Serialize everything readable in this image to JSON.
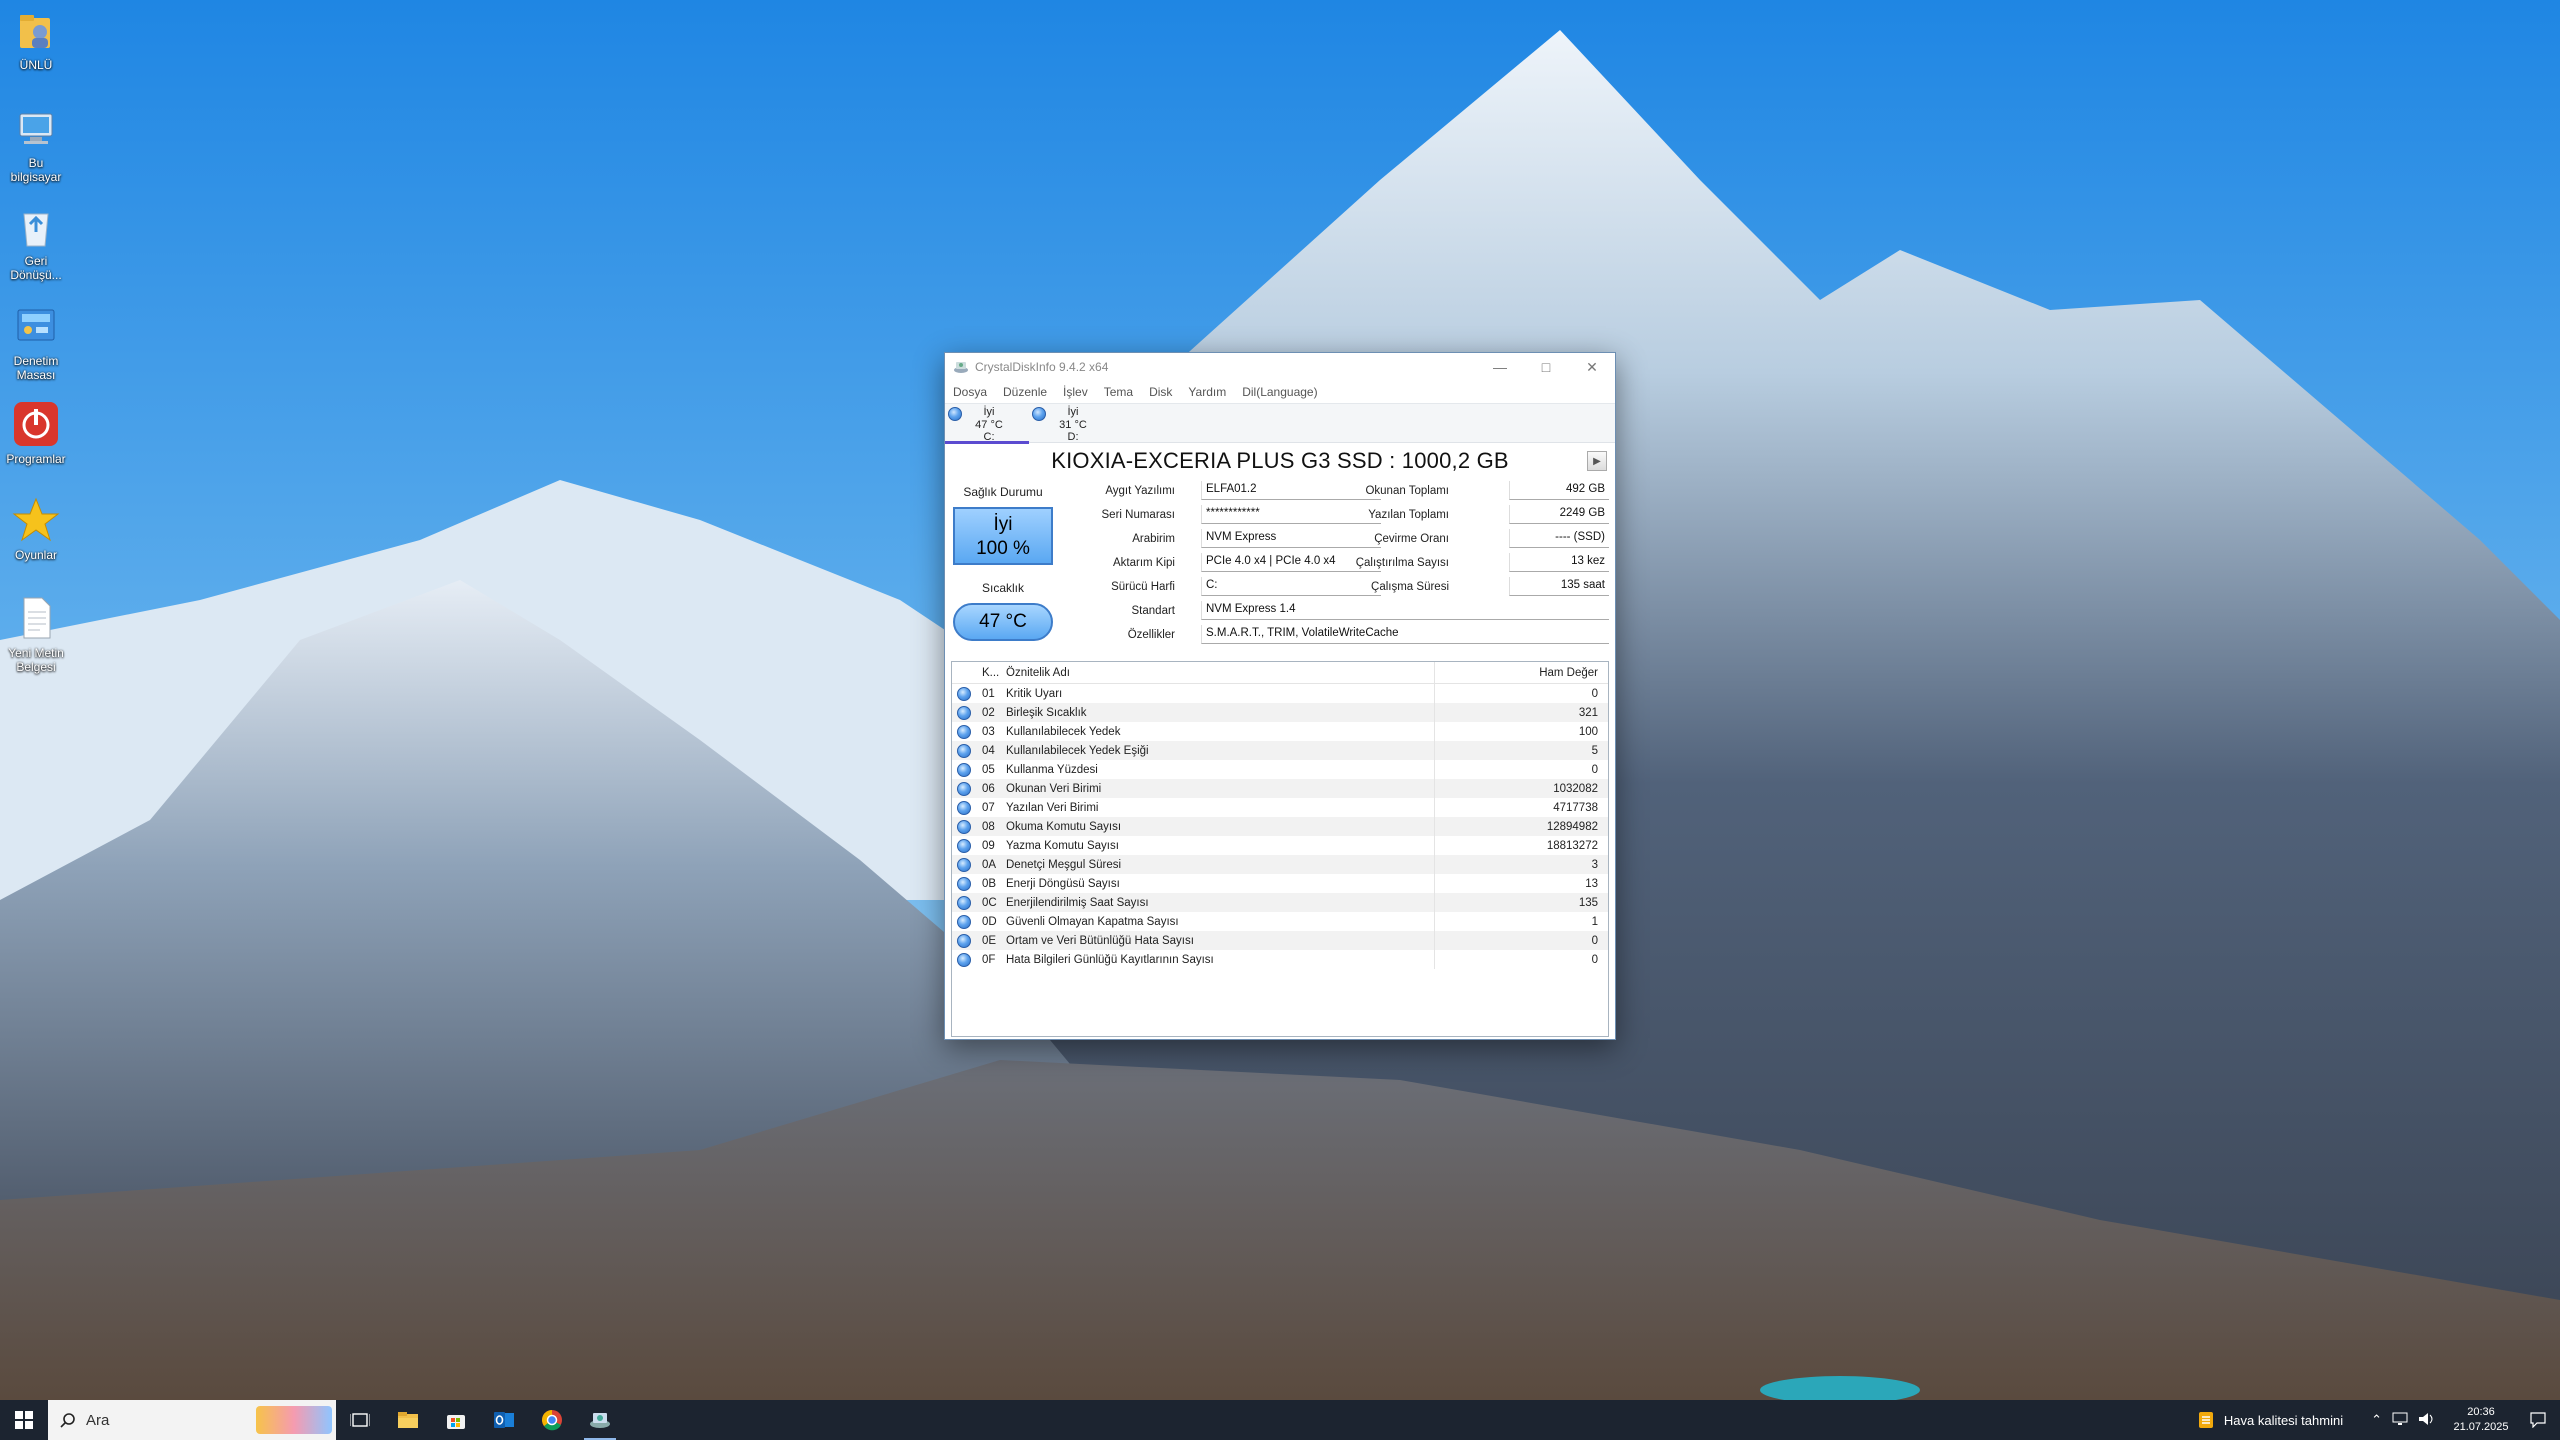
{
  "desktop": {
    "icons": [
      {
        "label": "ÜNLÜ"
      },
      {
        "label": "Bu bilgisayar"
      },
      {
        "label": "Geri Dönüşü..."
      },
      {
        "label": "Denetim Masası"
      },
      {
        "label": "Programlar"
      },
      {
        "label": "Oyunlar"
      },
      {
        "label": "Yeni Metin Belgesi"
      }
    ]
  },
  "window": {
    "title": "CrystalDiskInfo 9.4.2 x64",
    "menu": [
      "Dosya",
      "Düzenle",
      "İşlev",
      "Tema",
      "Disk",
      "Yardım",
      "Dil(Language)"
    ],
    "drives": [
      {
        "status": "İyi",
        "temp": "47 °C",
        "letter": "C:"
      },
      {
        "status": "İyi",
        "temp": "31 °C",
        "letter": "D:"
      }
    ],
    "model": "KIOXIA-EXCERIA PLUS G3 SSD : 1000,2 GB",
    "health_label": "Sağlık Durumu",
    "health_status": "İyi",
    "health_percent": "100 %",
    "temp_label": "Sıcaklık",
    "temp_value": "47 °C",
    "fields": {
      "firmware_label": "Aygıt Yazılımı",
      "firmware": "ELFA01.2",
      "serial_label": "Seri Numarası",
      "serial": "************",
      "interface_label": "Arabirim",
      "interface": "NVM Express",
      "transfer_label": "Aktarım Kipi",
      "transfer": "PCIe 4.0 x4 | PCIe 4.0 x4",
      "drive_letter_label": "Sürücü Harfi",
      "drive_letter": "C:",
      "standard_label": "Standart",
      "standard": "NVM Express 1.4",
      "features_label": "Özellikler",
      "features": "S.M.A.R.T., TRIM, VolatileWriteCache",
      "host_reads_label": "Okunan Toplamı",
      "host_reads": "492 GB",
      "host_writes_label": "Yazılan Toplamı",
      "host_writes": "2249 GB",
      "rotation_label": "Çevirme Oranı",
      "rotation": "---- (SSD)",
      "power_on_count_label": "Çalıştırılma Sayısı",
      "power_on_count": "13 kez",
      "power_on_hours_label": "Çalışma Süresi",
      "power_on_hours": "135 saat"
    },
    "table": {
      "col_id": "K...",
      "col_name": "Öznitelik Adı",
      "col_raw": "Ham Değer",
      "rows": [
        {
          "id": "01",
          "name": "Kritik Uyarı",
          "raw": "0"
        },
        {
          "id": "02",
          "name": "Birleşik Sıcaklık",
          "raw": "321"
        },
        {
          "id": "03",
          "name": "Kullanılabilecek Yedek",
          "raw": "100"
        },
        {
          "id": "04",
          "name": "Kullanılabilecek Yedek Eşiği",
          "raw": "5"
        },
        {
          "id": "05",
          "name": "Kullanma Yüzdesi",
          "raw": "0"
        },
        {
          "id": "06",
          "name": "Okunan Veri Birimi",
          "raw": "1032082"
        },
        {
          "id": "07",
          "name": "Yazılan Veri Birimi",
          "raw": "4717738"
        },
        {
          "id": "08",
          "name": "Okuma Komutu Sayısı",
          "raw": "12894982"
        },
        {
          "id": "09",
          "name": "Yazma Komutu Sayısı",
          "raw": "18813272"
        },
        {
          "id": "0A",
          "name": "Denetçi Meşgul Süresi",
          "raw": "3"
        },
        {
          "id": "0B",
          "name": "Enerji Döngüsü Sayısı",
          "raw": "13"
        },
        {
          "id": "0C",
          "name": "Enerjilendirilmiş Saat Sayısı",
          "raw": "135"
        },
        {
          "id": "0D",
          "name": "Güvenli Olmayan Kapatma Sayısı",
          "raw": "1"
        },
        {
          "id": "0E",
          "name": "Ortam ve Veri Bütünlüğü Hata Sayısı",
          "raw": "0"
        },
        {
          "id": "0F",
          "name": "Hata Bilgileri Günlüğü Kayıtlarının Sayısı",
          "raw": "0"
        }
      ]
    }
  },
  "taskbar": {
    "search_placeholder": "Ara",
    "weather_text": "Hava kalitesi tahmini",
    "time": "20:36",
    "date": "21.07.2025"
  }
}
